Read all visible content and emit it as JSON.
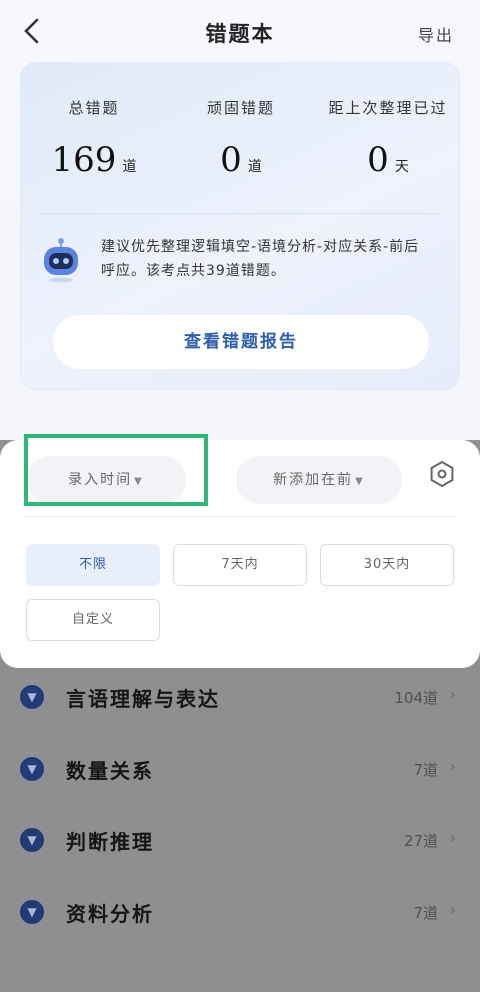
{
  "header": {
    "title": "错题本",
    "back_icon": "chevron-left-icon",
    "export_label": "导出"
  },
  "summary": {
    "stats": [
      {
        "label": "总错题",
        "value": "169",
        "unit": "道"
      },
      {
        "label": "顽固错题",
        "value": "0",
        "unit": "道"
      },
      {
        "label": "距上次整理已过",
        "value": "0",
        "unit": "天"
      }
    ],
    "tip": "建议优先整理逻辑填空-语境分析-对应关系-前后呼应。该考点共39道错题。",
    "report_button": "查看错题报告"
  },
  "filter": {
    "sort_field": "录入时间",
    "sort_order": "新添加在前",
    "settings_icon": "hexagon-settings-icon",
    "time_options": [
      "不限",
      "7天内",
      "30天内",
      "自定义"
    ],
    "selected_time": "不限",
    "highlight_color": "#2db87a"
  },
  "categories": [
    {
      "name": "言语理解与表达",
      "count": "104道"
    },
    {
      "name": "数量关系",
      "count": "7道"
    },
    {
      "name": "判断推理",
      "count": "27道"
    },
    {
      "name": "资料分析",
      "count": "7道"
    }
  ],
  "colors": {
    "accent": "#2f5fae",
    "category_icon": "#243c75"
  }
}
